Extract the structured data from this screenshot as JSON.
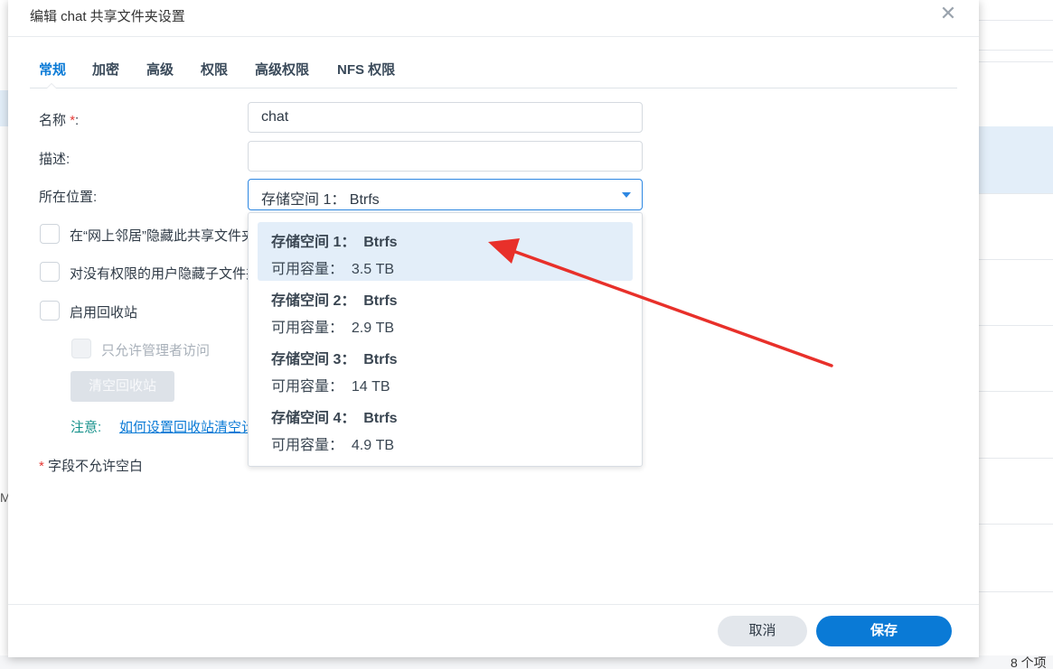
{
  "dialog": {
    "title": "编辑 chat 共享文件夹设置",
    "close_symbol": "✕"
  },
  "tabs": [
    {
      "label": "常规",
      "active": true
    },
    {
      "label": "加密"
    },
    {
      "label": "高级"
    },
    {
      "label": "权限"
    },
    {
      "label": "高级权限"
    },
    {
      "label": "NFS 权限"
    }
  ],
  "form": {
    "name_label": "名称",
    "name_required_mark": "*",
    "name_colon": ":",
    "name_value": "chat",
    "desc_label": "描述:",
    "desc_value": "",
    "location_label": "所在位置:",
    "location_value": "存储空间 1： Btrfs"
  },
  "checkboxes": {
    "hide_network": "在“网上邻居”隐藏此共享文件夹",
    "hide_subfolders": "对没有权限的用户隐藏子文件夹和文件",
    "recycle_bin": "启用回收站",
    "admin_only": "只允许管理者访问"
  },
  "recycle": {
    "clear_button": "清空回收站",
    "note_label": "注意:",
    "note_link": "如何设置回收站清空计划"
  },
  "footnote": {
    "mark": "*",
    "text": " 字段不允许空白"
  },
  "buttons": {
    "cancel": "取消",
    "save": "保存"
  },
  "dropdown": {
    "options": [
      {
        "name": "存储空间 1：  Btrfs",
        "capacity": "可用容量：  3.5 TB",
        "selected": true
      },
      {
        "name": "存储空间 2：  Btrfs",
        "capacity": "可用容量：  2.9 TB"
      },
      {
        "name": "存储空间 3：  Btrfs",
        "capacity": "可用容量：  14 TB"
      },
      {
        "name": "存储空间 4：  Btrfs",
        "capacity": "可用容量：  4.9 TB"
      }
    ]
  },
  "background": {
    "item_count": "8 个项",
    "left_fragment": "M"
  },
  "colors": {
    "accent": "#0a7ad6",
    "required": "#e53935",
    "note": "#14908a",
    "annotation_arrow": "#e8302a"
  }
}
